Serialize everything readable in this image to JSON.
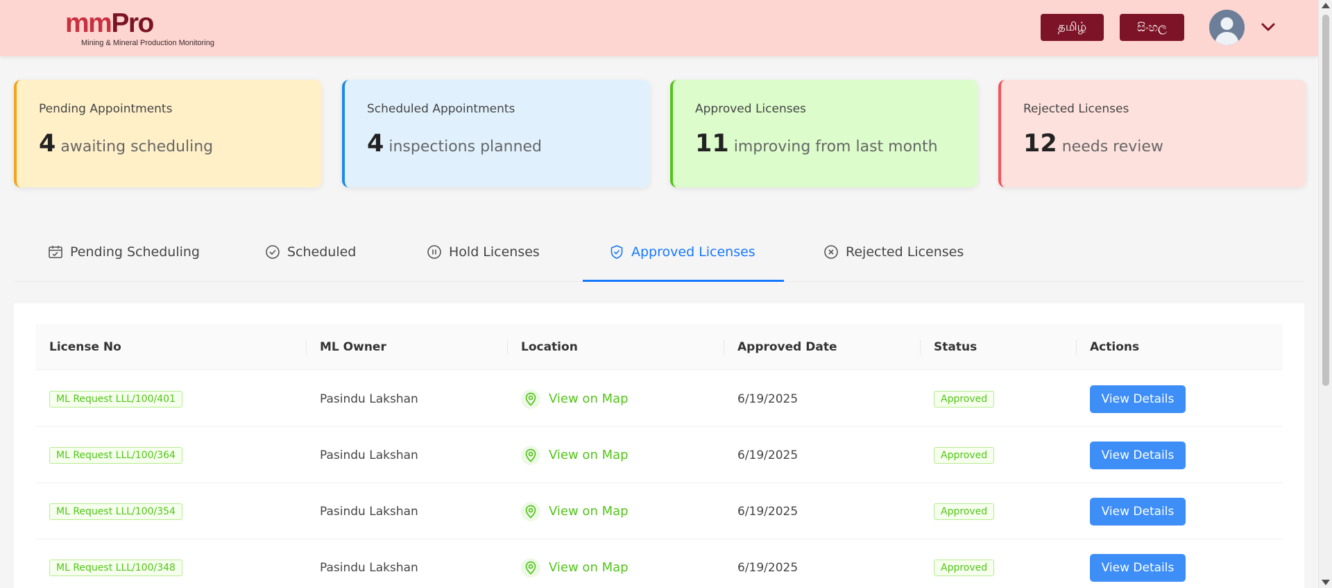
{
  "header": {
    "logo_mm": "mm",
    "logo_pro": "Pro",
    "logo_sub": "Mining & Mineral Production Monitoring",
    "lang_tamil": "தமிழ்",
    "lang_sinhala": "සිංහල"
  },
  "stats": [
    {
      "title": "Pending Appointments",
      "value": "4",
      "desc": "awaiting scheduling"
    },
    {
      "title": "Scheduled Appointments",
      "value": "4",
      "desc": "inspections planned"
    },
    {
      "title": "Approved Licenses",
      "value": "11",
      "desc": "improving from last month"
    },
    {
      "title": "Rejected Licenses",
      "value": "12",
      "desc": "needs review"
    }
  ],
  "tabs": [
    {
      "label": "Pending Scheduling",
      "icon": "calendar-icon"
    },
    {
      "label": "Scheduled",
      "icon": "check-circle-icon"
    },
    {
      "label": "Hold Licenses",
      "icon": "pause-circle-icon"
    },
    {
      "label": "Approved Licenses",
      "icon": "shield-check-icon",
      "active": true
    },
    {
      "label": "Rejected Licenses",
      "icon": "close-circle-icon"
    }
  ],
  "table": {
    "columns": [
      "License No",
      "ML Owner",
      "Location",
      "Approved Date",
      "Status",
      "Actions"
    ],
    "rows": [
      {
        "license": "ML Request LLL/100/401",
        "owner": "Pasindu Lakshan",
        "location": "View on Map",
        "date": "6/19/2025",
        "status": "Approved",
        "action": "View Details"
      },
      {
        "license": "ML Request LLL/100/364",
        "owner": "Pasindu Lakshan",
        "location": "View on Map",
        "date": "6/19/2025",
        "status": "Approved",
        "action": "View Details"
      },
      {
        "license": "ML Request LLL/100/354",
        "owner": "Pasindu Lakshan",
        "location": "View on Map",
        "date": "6/19/2025",
        "status": "Approved",
        "action": "View Details"
      },
      {
        "license": "ML Request LLL/100/348",
        "owner": "Pasindu Lakshan",
        "location": "View on Map",
        "date": "6/19/2025",
        "status": "Approved",
        "action": "View Details"
      }
    ]
  },
  "colors": {
    "header_bg": "#fdd5d1",
    "brand_dark": "#7d1326",
    "brand_red": "#c9303f",
    "accent_blue": "#1677ff",
    "success_green": "#52c41a"
  }
}
